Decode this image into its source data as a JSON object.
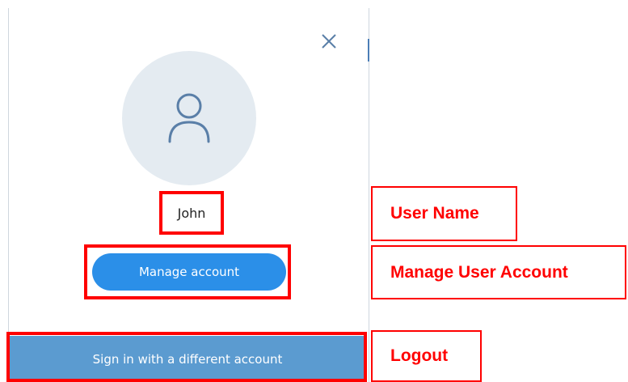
{
  "dialog": {
    "user_name": "John",
    "manage_account_label": "Manage account",
    "sign_in_different_label": "Sign in with a different account",
    "close_icon": "close-icon",
    "avatar_icon": "user-icon"
  },
  "annotations": {
    "user_name_label": "User Name",
    "manage_account_label": "Manage User Account",
    "logout_label": "Logout",
    "highlight_color": "#ff0000"
  },
  "colors": {
    "manage_button": "#2b8fe8",
    "sign_in_button": "#5b9bd0",
    "avatar_background": "#e4ebf1",
    "icon_stroke": "#5a7fa8"
  }
}
